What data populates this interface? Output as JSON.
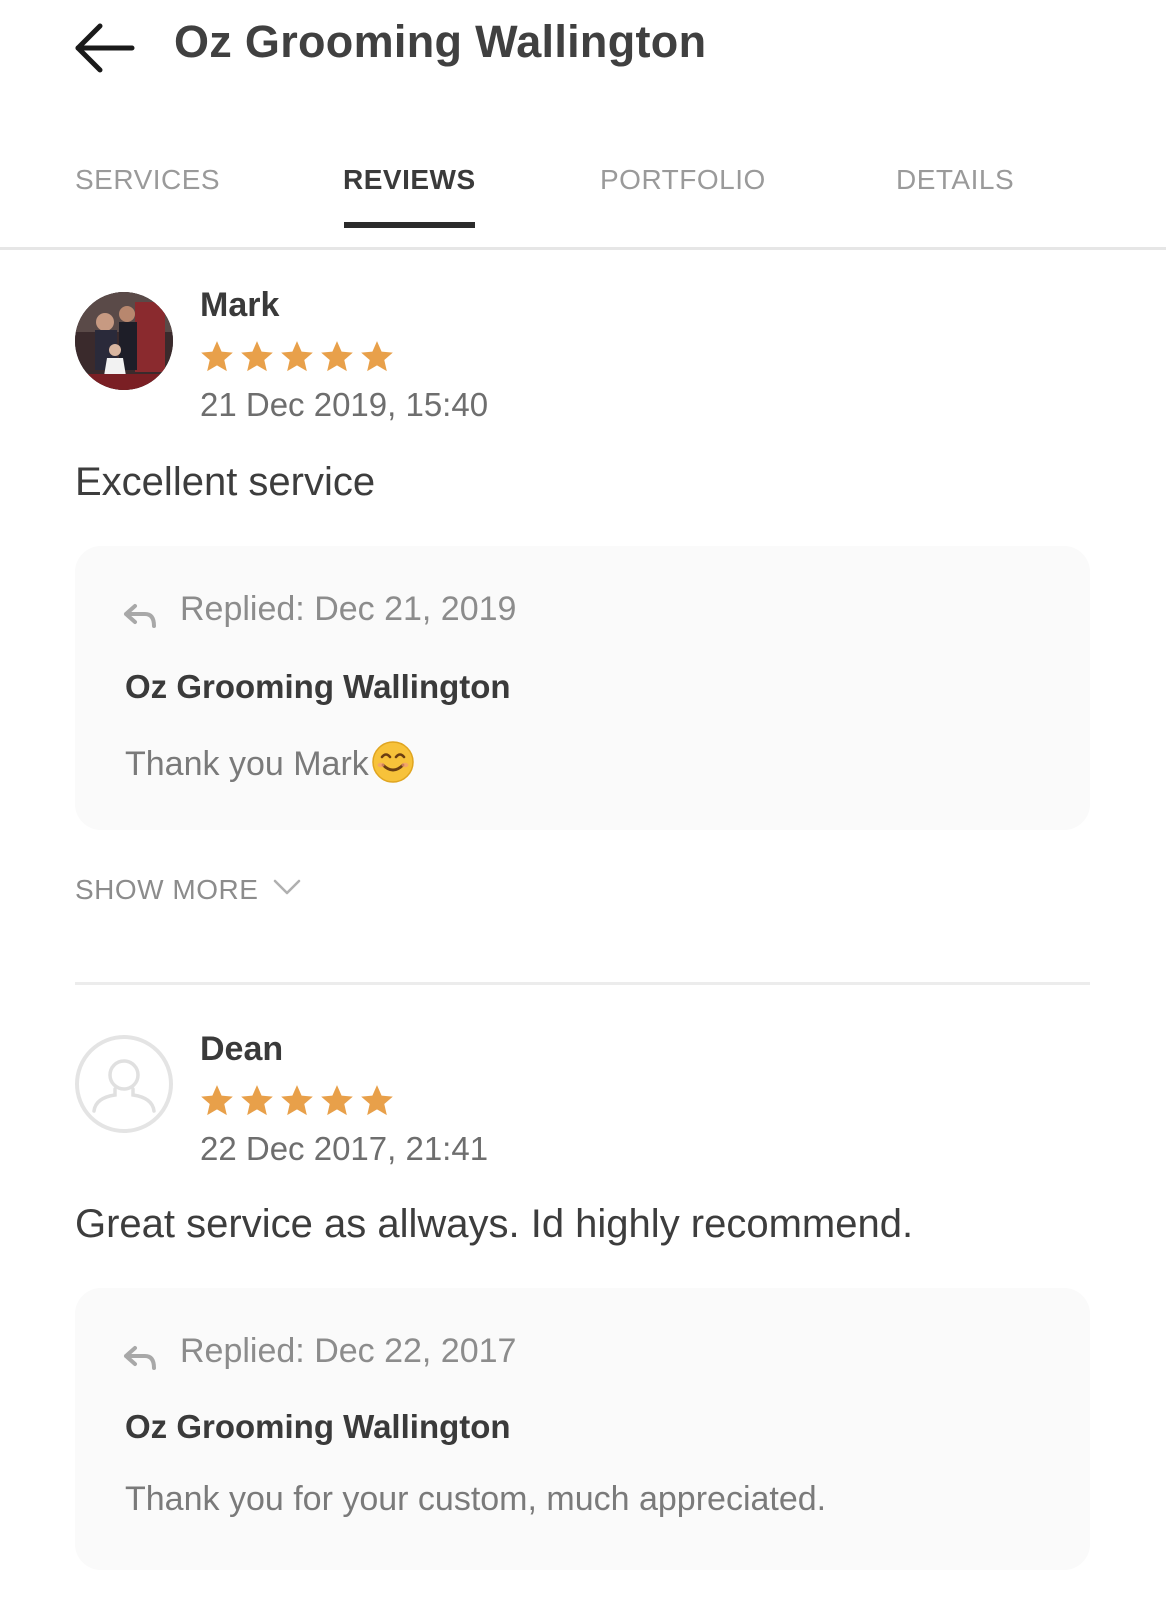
{
  "header": {
    "title": "Oz Grooming Wallington",
    "back_icon": "arrow-left-icon"
  },
  "tabs": [
    {
      "label": "SERVICES",
      "active": false
    },
    {
      "label": "REVIEWS",
      "active": true
    },
    {
      "label": "PORTFOLIO",
      "active": false
    },
    {
      "label": "DETAILS",
      "active": false
    }
  ],
  "colors": {
    "star": "#e8a04a",
    "active_tab": "#2b2b2b",
    "reply_background": "#fafafa"
  },
  "reviews": [
    {
      "name": "Mark",
      "rating": 5,
      "date": "21 Dec 2019, 15:40",
      "text": "Excellent service",
      "avatar": "user-photo",
      "reply": {
        "label": "Replied:  Dec 21, 2019",
        "author": "Oz Grooming Wallington",
        "text": "Thank you Mark",
        "emoji": "smiling-face-emoji"
      }
    },
    {
      "name": "Dean",
      "rating": 5,
      "date": "22 Dec 2017, 21:41",
      "text": "Great service as allways. Id highly recommend.",
      "avatar": "user-placeholder-icon",
      "reply": {
        "label": "Replied:  Dec 22, 2017",
        "author": "Oz Grooming Wallington",
        "text": "Thank you for your custom, much appreciated."
      }
    }
  ],
  "show_more": {
    "label": "SHOW MORE",
    "icon": "chevron-down-icon"
  }
}
